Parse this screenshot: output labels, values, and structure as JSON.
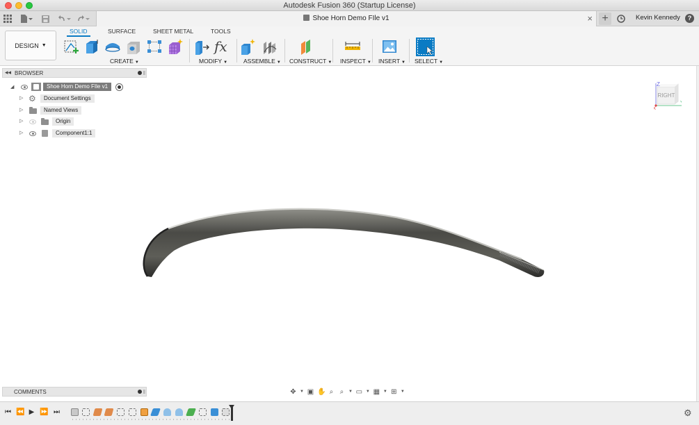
{
  "window": {
    "title": "Autodesk Fusion 360 (Startup License)"
  },
  "tabbar": {
    "document_title": "Shoe Horn Demo FIle v1",
    "user_name": "Kevin Kennedy",
    "help_label": "?",
    "close_label": "×",
    "new_tab_label": "+"
  },
  "ribbon": {
    "workspace_label": "DESIGN",
    "tabs": [
      {
        "label": "SOLID",
        "active": true
      },
      {
        "label": "SURFACE",
        "active": false
      },
      {
        "label": "SHEET METAL",
        "active": false
      },
      {
        "label": "TOOLS",
        "active": false
      }
    ],
    "groups": [
      {
        "label": "CREATE"
      },
      {
        "label": "MODIFY"
      },
      {
        "label": "ASSEMBLE"
      },
      {
        "label": "CONSTRUCT"
      },
      {
        "label": "INSPECT"
      },
      {
        "label": "INSERT"
      },
      {
        "label": "SELECT"
      }
    ],
    "fx_label": "fx"
  },
  "browser": {
    "title": "BROWSER",
    "items": [
      {
        "label": "Shoe Horn Demo FIle v1"
      },
      {
        "label": "Document Settings"
      },
      {
        "label": "Named Views"
      },
      {
        "label": "Origin"
      },
      {
        "label": "Component1:1"
      }
    ]
  },
  "comments": {
    "title": "COMMENTS"
  },
  "viewcube": {
    "face_label": "RIGHT",
    "axis_z": "Z",
    "axis_y": "Y",
    "axis_x": "X"
  },
  "colors": {
    "accent": "#0a7bc4",
    "model_dark": "#3e3e3a",
    "model_light": "#8f8f89"
  }
}
